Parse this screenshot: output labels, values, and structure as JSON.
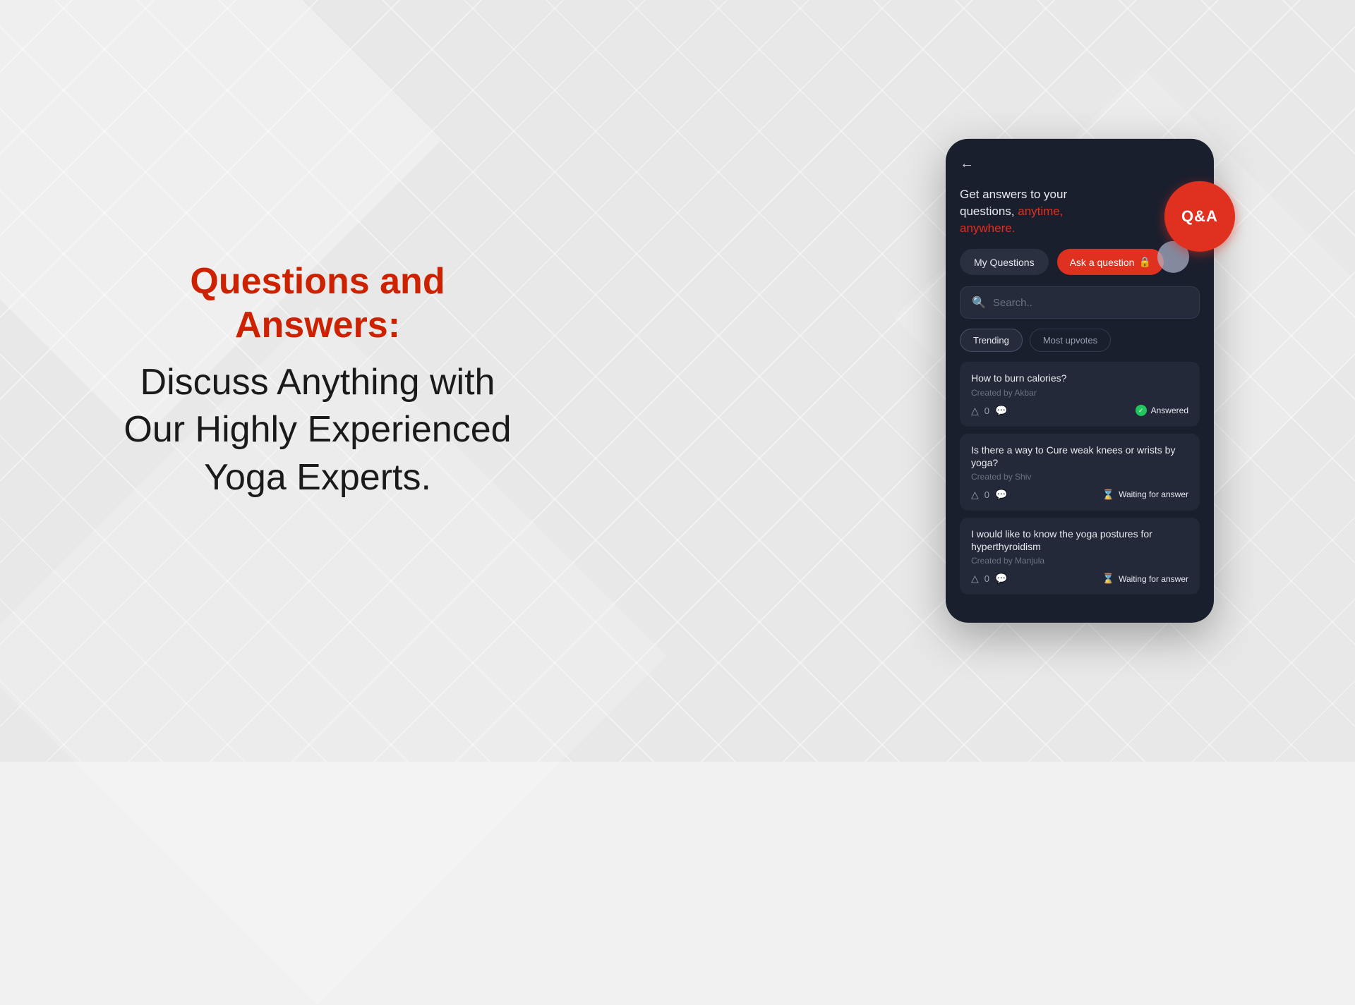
{
  "background": {
    "color": "#e8e8e8"
  },
  "left": {
    "title": "Questions and Answers:",
    "subtitle": "Discuss Anything with Our Highly Experienced Yoga Experts."
  },
  "phone": {
    "back_button": "←",
    "header": {
      "line1": "Get answers to your",
      "line2_normal": "questions,",
      "line2_highlight": "anytime,",
      "line3": "anywhere."
    },
    "qna_label": "Q&A",
    "buttons": {
      "my_questions": "My Questions",
      "ask_question": "Ask a question",
      "ask_lock_icon": "🔒"
    },
    "search": {
      "placeholder": "Search.."
    },
    "tabs": {
      "trending": "Trending",
      "most_upvotes": "Most upvotes"
    },
    "questions": [
      {
        "title": "How to burn calories?",
        "created_by": "Created by Akbar",
        "upvotes": "0",
        "status": "Answered",
        "status_type": "answered"
      },
      {
        "title": "Is there a way to Cure weak knees or wrists by yoga?",
        "created_by": "Created by Shiv",
        "upvotes": "0",
        "status": "Waiting for answer",
        "status_type": "waiting"
      },
      {
        "title": "I would like to know the yoga postures for hyperthyroidism",
        "created_by": "Created by Manjula",
        "upvotes": "0",
        "status": "Waiting for answer",
        "status_type": "waiting"
      }
    ]
  }
}
